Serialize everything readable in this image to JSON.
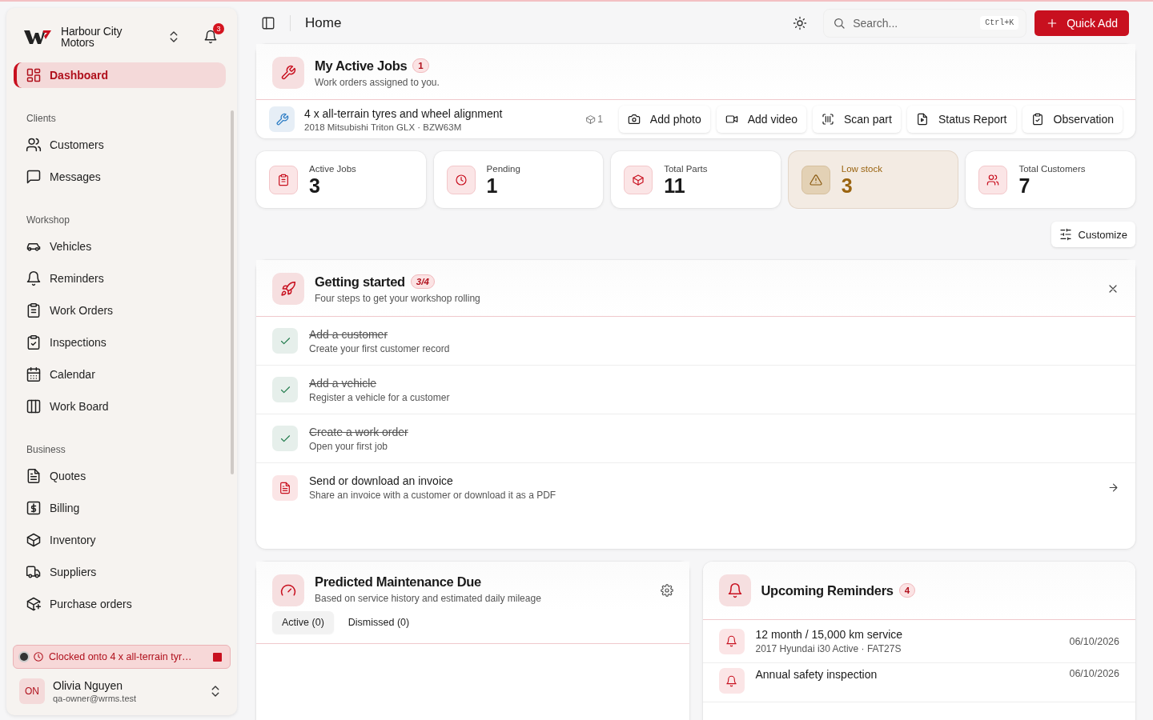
{
  "brand": {
    "name": "Harbour City Motors",
    "notifications": "3"
  },
  "sidebar": {
    "items": [
      {
        "label": "Dashboard",
        "selected": true
      }
    ],
    "sections": [
      {
        "heading": "Clients",
        "items": [
          {
            "label": "Customers",
            "selected": false
          },
          {
            "label": "Messages",
            "selected": false
          }
        ]
      },
      {
        "heading": "Workshop",
        "items": [
          {
            "label": "Vehicles",
            "selected": false
          },
          {
            "label": "Reminders",
            "selected": false
          },
          {
            "label": "Work Orders",
            "selected": false
          },
          {
            "label": "Inspections",
            "selected": false
          },
          {
            "label": "Calendar",
            "selected": false
          },
          {
            "label": "Work Board",
            "selected": false
          }
        ]
      },
      {
        "heading": "Business",
        "items": [
          {
            "label": "Quotes",
            "selected": false
          },
          {
            "label": "Billing",
            "selected": false
          },
          {
            "label": "Inventory",
            "selected": false
          },
          {
            "label": "Suppliers",
            "selected": false
          },
          {
            "label": "Purchase orders",
            "selected": false
          }
        ]
      }
    ]
  },
  "clock_banner": {
    "text": "Clocked onto 4 x all-terrain tyr…"
  },
  "user": {
    "initials": "ON",
    "name": "Olivia Nguyen",
    "email": "qa-owner@wrms.test"
  },
  "topbar": {
    "title": "Home",
    "search": {
      "placeholder": "Search...",
      "shortcut": "Ctrl+K"
    },
    "quick_add": "Quick Add"
  },
  "active_jobs": {
    "title": "My Active Jobs",
    "count": "1",
    "subtitle": "Work orders assigned to you.",
    "job": {
      "title": "4 x all-terrain tyres and wheel alignment",
      "vehicle": "2018 Mitsubishi Triton GLX · BZW63M",
      "parts": "1"
    },
    "actions": [
      "Add photo",
      "Add video",
      "Scan part",
      "Status Report",
      "Observation"
    ]
  },
  "stats": [
    {
      "label": "Active Jobs",
      "value": "3",
      "kind": "normal"
    },
    {
      "label": "Pending",
      "value": "1",
      "kind": "normal"
    },
    {
      "label": "Total Parts",
      "value": "11",
      "kind": "normal"
    },
    {
      "label": "Low stock",
      "value": "3",
      "kind": "warning"
    },
    {
      "label": "Total Customers",
      "value": "7",
      "kind": "normal"
    }
  ],
  "customize": "Customize",
  "getting_started": {
    "title": "Getting started",
    "progress": "3/4",
    "subtitle": "Four steps to get your workshop rolling",
    "steps": [
      {
        "title": "Add a customer",
        "description": "Create your first customer record",
        "done": true
      },
      {
        "title": "Add a vehicle",
        "description": "Register a vehicle for a customer",
        "done": true
      },
      {
        "title": "Create a work order",
        "description": "Open your first job",
        "done": true
      },
      {
        "title": "Send or download an invoice",
        "description": "Share an invoice with a customer or download it as a PDF",
        "done": false
      }
    ]
  },
  "maintenance": {
    "title": "Predicted Maintenance Due",
    "subtitle": "Based on service history and estimated daily mileage",
    "tabs": [
      {
        "label": "Active (0)",
        "selected": true
      },
      {
        "label": "Dismissed (0)",
        "selected": false
      }
    ]
  },
  "reminders": {
    "title": "Upcoming Reminders",
    "count": "4",
    "items": [
      {
        "title": "12 month / 15,000 km service",
        "vehicle": "2017 Hyundai i30 Active · FAT27S",
        "date": "06/10/2026"
      },
      {
        "title": "Annual safety inspection",
        "date": "06/10/2026"
      }
    ]
  }
}
